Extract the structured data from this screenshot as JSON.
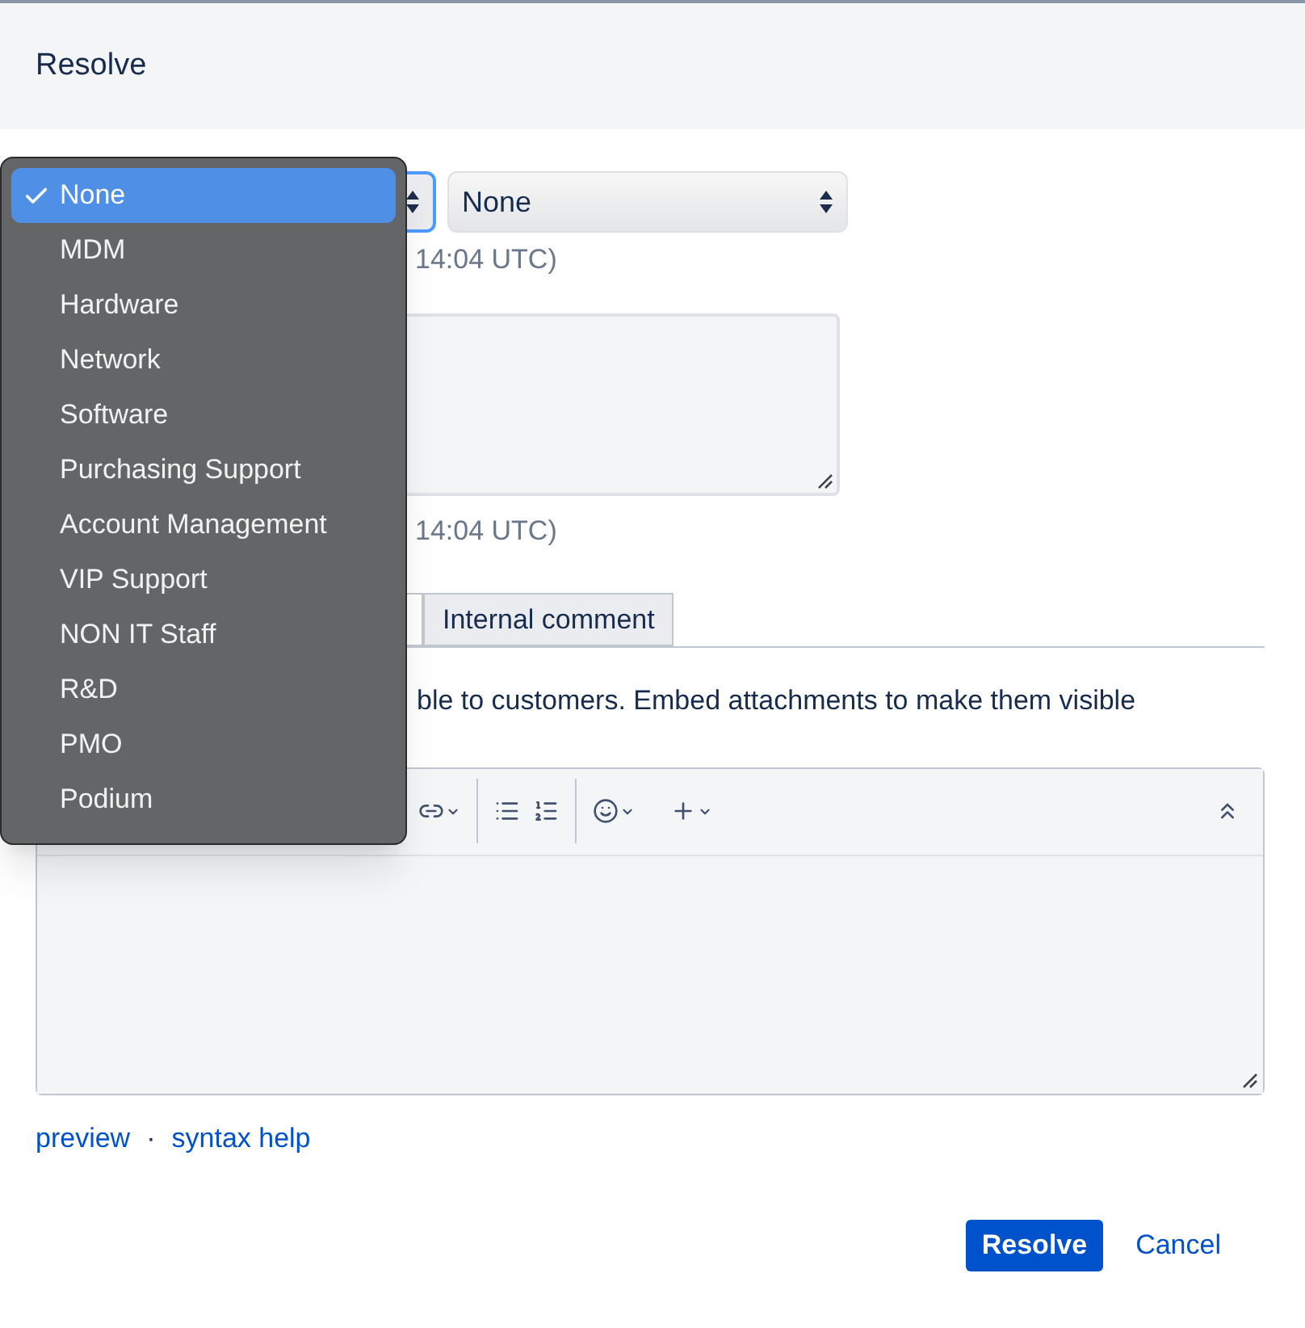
{
  "dialog": {
    "title": "Resolve"
  },
  "category_menu": {
    "options": [
      {
        "label": "None",
        "selected": true
      },
      {
        "label": "MDM",
        "selected": false
      },
      {
        "label": "Hardware",
        "selected": false
      },
      {
        "label": "Network",
        "selected": false
      },
      {
        "label": "Software",
        "selected": false
      },
      {
        "label": "Purchasing Support",
        "selected": false
      },
      {
        "label": "Account Management",
        "selected": false
      },
      {
        "label": "VIP Support",
        "selected": false
      },
      {
        "label": "NON IT Staff",
        "selected": false
      },
      {
        "label": "R&D",
        "selected": false
      },
      {
        "label": "PMO",
        "selected": false
      },
      {
        "label": "Podium",
        "selected": false
      }
    ]
  },
  "second_select": {
    "value": "None"
  },
  "timestamp_1": "14:04 UTC)",
  "timestamp_2": "14:04 UTC)",
  "comment_tabs": [
    {
      "label": "Internal comment",
      "selected": false
    }
  ],
  "comment_hint": "ble to customers. Embed attachments to make them visible",
  "editor_links": {
    "preview": "preview",
    "separator": "·",
    "help": "syntax help"
  },
  "buttons": {
    "primary": "Resolve",
    "secondary": "Cancel"
  }
}
